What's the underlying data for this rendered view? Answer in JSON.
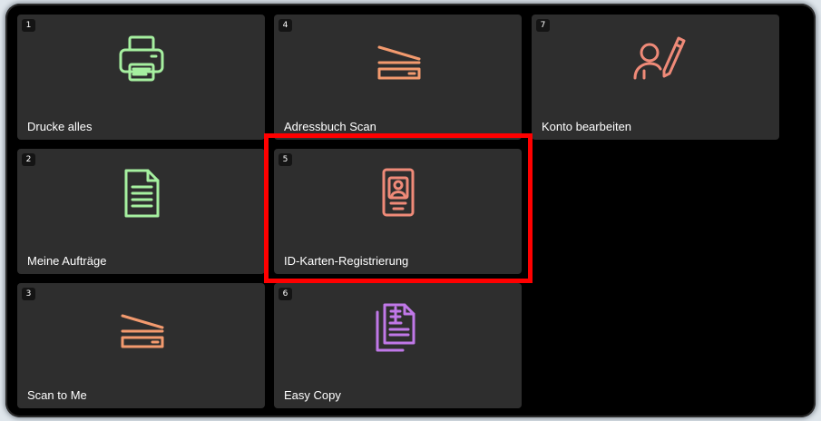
{
  "colors": {
    "green": "#a6f0a0",
    "orange": "#f39a6e",
    "salmon": "#ef8a78",
    "purple": "#c078e8",
    "tile_bg": "#2e2e2e",
    "highlight": "#ff0000"
  },
  "tiles": [
    {
      "number": "1",
      "label": "Drucke alles",
      "icon": "printer-icon"
    },
    {
      "number": "2",
      "label": "Meine Aufträge",
      "icon": "document-icon"
    },
    {
      "number": "3",
      "label": "Scan to Me",
      "icon": "scanner-icon"
    },
    {
      "number": "4",
      "label": "Adressbuch Scan",
      "icon": "scanner-icon"
    },
    {
      "number": "5",
      "label": "ID-Karten-Registrierung",
      "icon": "id-card-icon",
      "highlighted": true
    },
    {
      "number": "6",
      "label": "Easy Copy",
      "icon": "copy-documents-icon"
    },
    {
      "number": "7",
      "label": "Konto bearbeiten",
      "icon": "edit-account-icon"
    }
  ]
}
